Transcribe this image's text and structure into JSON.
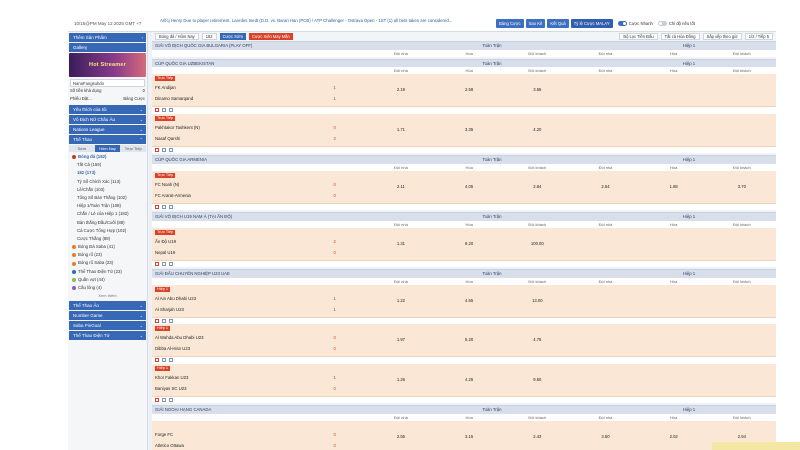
{
  "topbar": {
    "clock": "10/15@PM May 12 2025 GMT +7",
    "ticker": "Arifcj Henry Due to player retirement, Lanrdes Inedt (D.D. vs. Baran Han (PCB) / ATP Challenger - Ostrava Open - 1ST (1) all bets taken are considered...",
    "buttons": [
      "Bảng Cược",
      "Sao Kê",
      "Kết Quả",
      "Tỷ lệ Cược MALAY"
    ],
    "toggle1": "Cược Nhanh",
    "toggle2": "Chỉ độ nếu tốt"
  },
  "sidebar": {
    "top_btn": "Thêm Sản Phẩm",
    "gallery": "Gallery",
    "banner": "Hot Streamer",
    "username": "NanaFangsuhdo",
    "balance_label": "Số tiền khả dụng",
    "balance_value": "0",
    "phone_label": "Phiếu Đặt...",
    "phone_value": "Bảng Cược",
    "sections": [
      "Yêu thích của tôi",
      "Vô Địch Nữ Châu Âu",
      "Nations League",
      "Thể Thao"
    ],
    "subtabs": [
      "Sớm",
      "Hôm Nay",
      "Trực Tiếp"
    ],
    "sport_main": "Bóng đá (182)",
    "items": [
      "Tất Cả (159)",
      "182 (173)",
      "Tỷ Số Chính Xác (113)",
      "Lẻ/Chẵn (103)",
      "Tổng Số Bàn Thắng (102)",
      "Hiệp 1/Toàn Trận (108)",
      "Chẵn / Lẻ của Hiệp 1 (182)",
      "Bàn thắng Đầu/Cuối (88)",
      "Cá Cược Tổng Hợp (102)",
      "Cược Thắng (88)"
    ],
    "sports": [
      "Bóng Đá Saba (41)",
      "Bóng rổ (23)",
      "Bóng rổ Saba (23)",
      "Thể Thao Điện Tử (23)",
      "Quần vợt (44)",
      "Cầu lông (4)"
    ],
    "more": "Xem thêm",
    "bottom_sections": [
      "Thể Thao Ảo",
      "Number Game",
      "Saba PinGoal",
      "Thể Thao Điện Tử"
    ]
  },
  "filters": {
    "sport": "Bóng đá / Hôm Nay",
    "count": "182",
    "live_btn": "Cược Sớm",
    "hot_btn": "Cược Xiên May Mắn",
    "sort": "Bộ Lọc Tiền Đấu",
    "time": "Tất cả Hòa Đồng",
    "order": "Sắp xếp theo giờ",
    "page": "1/2 / Tiếp 5"
  },
  "columns": {
    "full": "Toàn Trận",
    "half": "Hiệp 1",
    "home": "Đội nhà",
    "draw": "Hòa",
    "away": "Đội khách"
  },
  "leagues": [
    {
      "name": "GIẢI VÔ ĐỊCH QUỐC GIA BULGARIA (PLAY OFF)",
      "matches": []
    },
    {
      "name": "CÚP QUỐC GIA UZBEKISTAN",
      "matches": [
        {
          "tag": "Trực Tiếp",
          "home": "FK Andijan",
          "away": "Dinamo Samarqand",
          "hs": "1",
          "as": "1",
          "o": [
            "2.19",
            "2.58",
            "3.65",
            "",
            "",
            ""
          ]
        },
        {
          "tag": "Trực Tiếp",
          "home": "Pakhtakor Tashkent (N)",
          "away": "Nasaf Qarshi",
          "hs": "0",
          "as": "2",
          "o": [
            "1.71",
            "3.35",
            "4.20",
            "",
            "",
            ""
          ]
        }
      ]
    },
    {
      "name": "CÚP QUỐC GIA ARMENIA",
      "matches": [
        {
          "tag": "Trực Tiếp",
          "home": "FC Noah (N)",
          "away": "FC Ararat-Armenia",
          "hs": "0",
          "as": "0",
          "o": [
            "2.11",
            "4.05",
            "2.84",
            "2.64",
            "1.88",
            "3.70"
          ]
        }
      ]
    },
    {
      "name": "GIẢI VÔ ĐỊCH U19 NAM Á (TẠI ẤN ĐỘ)",
      "matches": [
        {
          "tag": "Trực Tiếp",
          "home": "Ấn Độ U19",
          "away": "Nepal U19",
          "hs": "2",
          "as": "0",
          "o": [
            "1.31",
            "8.20",
            "100.00",
            "",
            "",
            ""
          ]
        }
      ]
    },
    {
      "name": "GIẢI ĐẤU CHUYÊN NGHIỆP U23 UAE",
      "matches": [
        {
          "tag": "Hiệp 1",
          "home": "Al Ain Abu Dhabi U23",
          "away": "Al Sharjah U23",
          "hs": "1",
          "as": "1",
          "o": [
            "1.22",
            "4.55",
            "13.00",
            "",
            "",
            ""
          ]
        },
        {
          "tag": "Hiệp 1",
          "home": "Al Wahda Abu Dhabi U23",
          "away": "Dibba Al-Hisn U23",
          "hs": "0",
          "as": "0",
          "o": [
            "1.97",
            "5.20",
            "4.75",
            "",
            "",
            ""
          ]
        },
        {
          "tag": "Hiệp 1",
          "home": "Khor Fakkan U23",
          "away": "Baniyas SC U23",
          "hs": "1",
          "as": "0",
          "o": [
            "1.26",
            "4.25",
            "9.60",
            "",
            "",
            ""
          ]
        }
      ]
    },
    {
      "name": "GIẢI NGOẠI HẠNG CANADA",
      "matches": [
        {
          "tag": "",
          "home": "Forge FC",
          "away": "Atletico Ottawa",
          "hs": "0",
          "as": "0",
          "o": [
            "2.55",
            "3.15",
            "2.43",
            "3.50",
            "2.02",
            "2.94"
          ]
        }
      ]
    }
  ],
  "scroll_top": "↑"
}
